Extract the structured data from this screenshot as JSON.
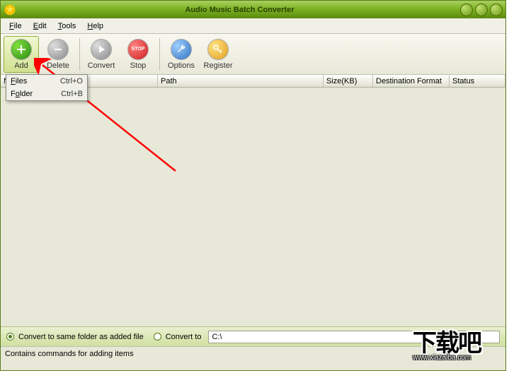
{
  "window": {
    "title": "Audio Music Batch Converter"
  },
  "menu": {
    "file": "File",
    "edit": "Edit",
    "tools": "Tools",
    "help": "Help"
  },
  "toolbar": {
    "add": "Add",
    "delete": "Delete",
    "convert": "Convert",
    "stop": "Stop",
    "options": "Options",
    "register": "Register"
  },
  "columns": {
    "name": "Name",
    "path": "Path",
    "size": "Size(KB)",
    "format": "Destination Format",
    "status": "Status"
  },
  "dropdown": {
    "files": {
      "label": "Files",
      "shortcut": "Ctrl+O"
    },
    "folder": {
      "label": "Folder",
      "shortcut": "Ctrl+B"
    }
  },
  "bottom": {
    "same_folder": "Convert to same folder as added file",
    "convert_to": "Convert to",
    "path": "C:\\"
  },
  "status": "Contains commands for adding items",
  "watermark": {
    "text": "下载吧",
    "url": "www.xiazaiba.com"
  }
}
